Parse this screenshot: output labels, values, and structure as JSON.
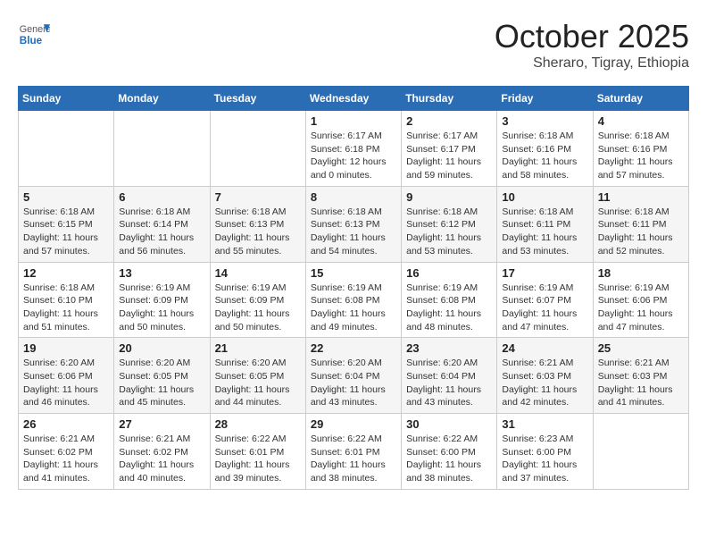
{
  "header": {
    "logo_line1": "General",
    "logo_line2": "Blue",
    "month": "October 2025",
    "location": "Sheraro, Tigray, Ethiopia"
  },
  "days_of_week": [
    "Sunday",
    "Monday",
    "Tuesday",
    "Wednesday",
    "Thursday",
    "Friday",
    "Saturday"
  ],
  "weeks": [
    [
      {
        "day": "",
        "info": ""
      },
      {
        "day": "",
        "info": ""
      },
      {
        "day": "",
        "info": ""
      },
      {
        "day": "1",
        "info": "Sunrise: 6:17 AM\nSunset: 6:18 PM\nDaylight: 12 hours\nand 0 minutes."
      },
      {
        "day": "2",
        "info": "Sunrise: 6:17 AM\nSunset: 6:17 PM\nDaylight: 11 hours\nand 59 minutes."
      },
      {
        "day": "3",
        "info": "Sunrise: 6:18 AM\nSunset: 6:16 PM\nDaylight: 11 hours\nand 58 minutes."
      },
      {
        "day": "4",
        "info": "Sunrise: 6:18 AM\nSunset: 6:16 PM\nDaylight: 11 hours\nand 57 minutes."
      }
    ],
    [
      {
        "day": "5",
        "info": "Sunrise: 6:18 AM\nSunset: 6:15 PM\nDaylight: 11 hours\nand 57 minutes."
      },
      {
        "day": "6",
        "info": "Sunrise: 6:18 AM\nSunset: 6:14 PM\nDaylight: 11 hours\nand 56 minutes."
      },
      {
        "day": "7",
        "info": "Sunrise: 6:18 AM\nSunset: 6:13 PM\nDaylight: 11 hours\nand 55 minutes."
      },
      {
        "day": "8",
        "info": "Sunrise: 6:18 AM\nSunset: 6:13 PM\nDaylight: 11 hours\nand 54 minutes."
      },
      {
        "day": "9",
        "info": "Sunrise: 6:18 AM\nSunset: 6:12 PM\nDaylight: 11 hours\nand 53 minutes."
      },
      {
        "day": "10",
        "info": "Sunrise: 6:18 AM\nSunset: 6:11 PM\nDaylight: 11 hours\nand 53 minutes."
      },
      {
        "day": "11",
        "info": "Sunrise: 6:18 AM\nSunset: 6:11 PM\nDaylight: 11 hours\nand 52 minutes."
      }
    ],
    [
      {
        "day": "12",
        "info": "Sunrise: 6:18 AM\nSunset: 6:10 PM\nDaylight: 11 hours\nand 51 minutes."
      },
      {
        "day": "13",
        "info": "Sunrise: 6:19 AM\nSunset: 6:09 PM\nDaylight: 11 hours\nand 50 minutes."
      },
      {
        "day": "14",
        "info": "Sunrise: 6:19 AM\nSunset: 6:09 PM\nDaylight: 11 hours\nand 50 minutes."
      },
      {
        "day": "15",
        "info": "Sunrise: 6:19 AM\nSunset: 6:08 PM\nDaylight: 11 hours\nand 49 minutes."
      },
      {
        "day": "16",
        "info": "Sunrise: 6:19 AM\nSunset: 6:08 PM\nDaylight: 11 hours\nand 48 minutes."
      },
      {
        "day": "17",
        "info": "Sunrise: 6:19 AM\nSunset: 6:07 PM\nDaylight: 11 hours\nand 47 minutes."
      },
      {
        "day": "18",
        "info": "Sunrise: 6:19 AM\nSunset: 6:06 PM\nDaylight: 11 hours\nand 47 minutes."
      }
    ],
    [
      {
        "day": "19",
        "info": "Sunrise: 6:20 AM\nSunset: 6:06 PM\nDaylight: 11 hours\nand 46 minutes."
      },
      {
        "day": "20",
        "info": "Sunrise: 6:20 AM\nSunset: 6:05 PM\nDaylight: 11 hours\nand 45 minutes."
      },
      {
        "day": "21",
        "info": "Sunrise: 6:20 AM\nSunset: 6:05 PM\nDaylight: 11 hours\nand 44 minutes."
      },
      {
        "day": "22",
        "info": "Sunrise: 6:20 AM\nSunset: 6:04 PM\nDaylight: 11 hours\nand 43 minutes."
      },
      {
        "day": "23",
        "info": "Sunrise: 6:20 AM\nSunset: 6:04 PM\nDaylight: 11 hours\nand 43 minutes."
      },
      {
        "day": "24",
        "info": "Sunrise: 6:21 AM\nSunset: 6:03 PM\nDaylight: 11 hours\nand 42 minutes."
      },
      {
        "day": "25",
        "info": "Sunrise: 6:21 AM\nSunset: 6:03 PM\nDaylight: 11 hours\nand 41 minutes."
      }
    ],
    [
      {
        "day": "26",
        "info": "Sunrise: 6:21 AM\nSunset: 6:02 PM\nDaylight: 11 hours\nand 41 minutes."
      },
      {
        "day": "27",
        "info": "Sunrise: 6:21 AM\nSunset: 6:02 PM\nDaylight: 11 hours\nand 40 minutes."
      },
      {
        "day": "28",
        "info": "Sunrise: 6:22 AM\nSunset: 6:01 PM\nDaylight: 11 hours\nand 39 minutes."
      },
      {
        "day": "29",
        "info": "Sunrise: 6:22 AM\nSunset: 6:01 PM\nDaylight: 11 hours\nand 38 minutes."
      },
      {
        "day": "30",
        "info": "Sunrise: 6:22 AM\nSunset: 6:00 PM\nDaylight: 11 hours\nand 38 minutes."
      },
      {
        "day": "31",
        "info": "Sunrise: 6:23 AM\nSunset: 6:00 PM\nDaylight: 11 hours\nand 37 minutes."
      },
      {
        "day": "",
        "info": ""
      }
    ]
  ]
}
